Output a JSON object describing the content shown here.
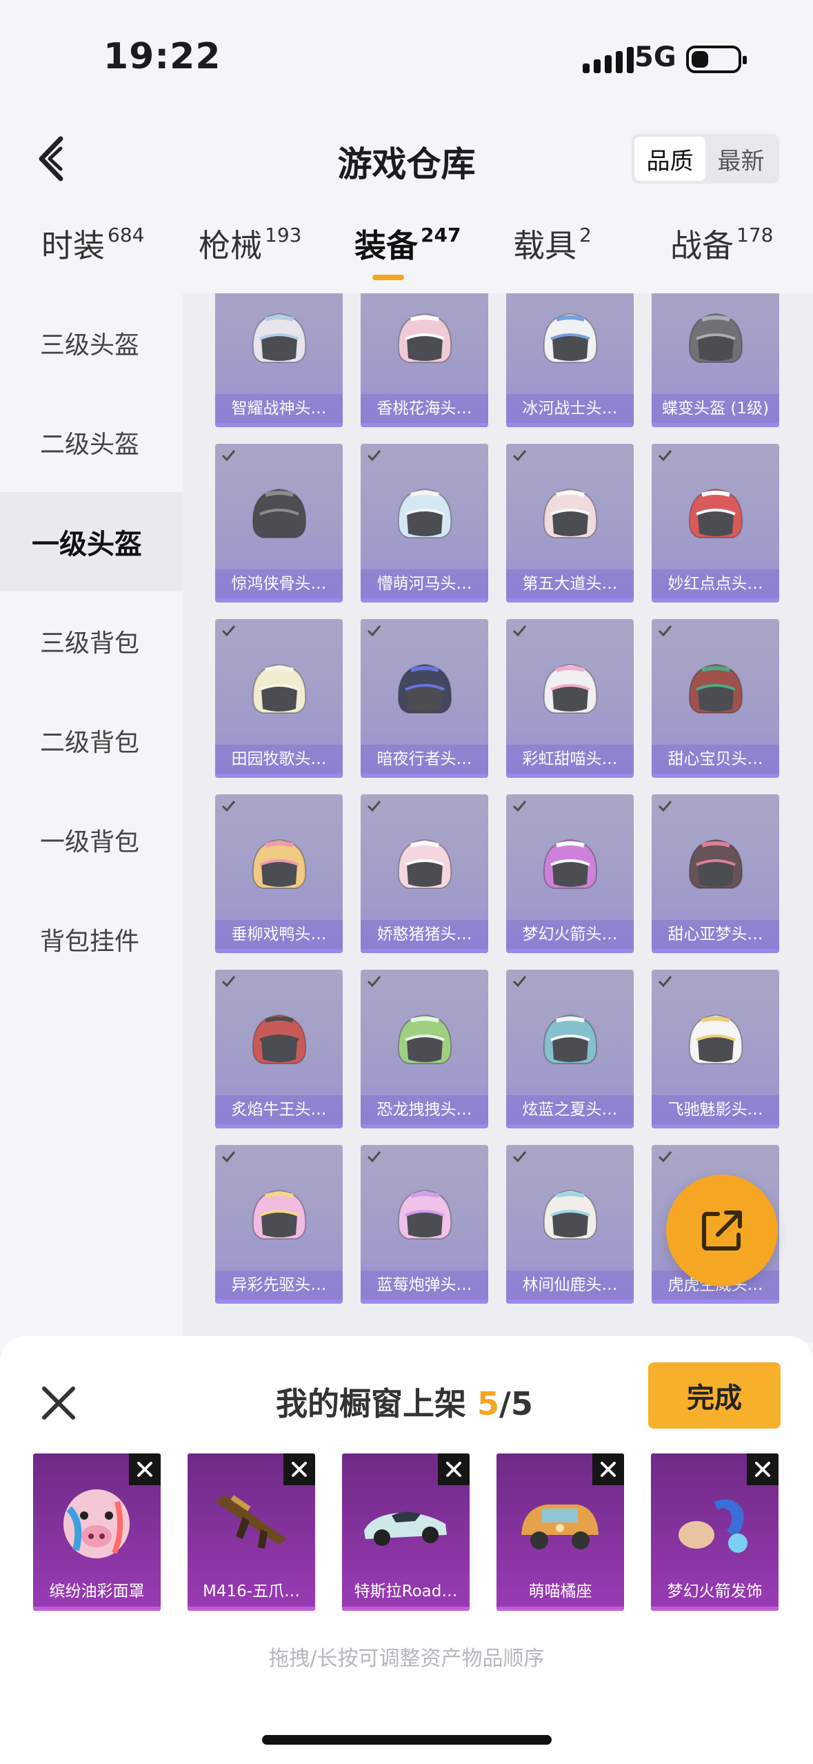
{
  "status_bar": {
    "time": "19:22",
    "network": "5G"
  },
  "nav": {
    "title": "游戏仓库",
    "sort_options": [
      "品质",
      "最新"
    ],
    "active_sort": "品质"
  },
  "categories": [
    {
      "label": "时装",
      "count": "684"
    },
    {
      "label": "枪械",
      "count": "193"
    },
    {
      "label": "装备",
      "count": "247"
    },
    {
      "label": "载具",
      "count": "2"
    },
    {
      "label": "战备",
      "count": "178"
    }
  ],
  "sidebar": {
    "items": [
      "三级头盔",
      "二级头盔",
      "一级头盔",
      "三级背包",
      "二级背包",
      "一级背包",
      "背包挂件"
    ],
    "active": "一级头盔"
  },
  "grid": {
    "items": [
      {
        "name": "智耀战神头…",
        "color": "#e6e4ea",
        "accent": "#a9c6e8"
      },
      {
        "name": "香桃花海头…",
        "color": "#f1c4cf",
        "accent": "#ffffff"
      },
      {
        "name": "冰河战士头…",
        "color": "#f2f2f4",
        "accent": "#5b8fd6"
      },
      {
        "name": "蝶变头盔 (1级)",
        "color": "#55565c",
        "accent": "#9aa0a8"
      },
      {
        "name": "惊鸿侠骨头…",
        "color": "#2b2b2e",
        "accent": "#777"
      },
      {
        "name": "懵萌河马头…",
        "color": "#cfe6f4",
        "accent": "#f7f7f7"
      },
      {
        "name": "第五大道头…",
        "color": "#f3d9d9",
        "accent": "#ffffff"
      },
      {
        "name": "妙红点点头…",
        "color": "#d73a3a",
        "accent": "#ffffff"
      },
      {
        "name": "田园牧歌头…",
        "color": "#f3ecc8",
        "accent": "#f9f5e0"
      },
      {
        "name": "暗夜行者头…",
        "color": "#1f2340",
        "accent": "#4b5bd8"
      },
      {
        "name": "彩虹甜喵头…",
        "color": "#f3f0f3",
        "accent": "#f0a3c6"
      },
      {
        "name": "甜心宝贝头…",
        "color": "#8e2f2a",
        "accent": "#2e9b6a"
      },
      {
        "name": "垂柳戏鸭头…",
        "color": "#f3c36b",
        "accent": "#f08aa0"
      },
      {
        "name": "娇憨猪猪头…",
        "color": "#f6d3dc",
        "accent": "#ffffff"
      },
      {
        "name": "梦幻火箭头…",
        "color": "#c86ad6",
        "accent": "#ffffff"
      },
      {
        "name": "甜心亚梦头…",
        "color": "#4a3036",
        "accent": "#d46a85"
      },
      {
        "name": "炙焰牛王头…",
        "color": "#c23a36",
        "accent": "#2a2a2a"
      },
      {
        "name": "恐龙拽拽头…",
        "color": "#8fca6a",
        "accent": "#e8f5dd"
      },
      {
        "name": "炫蓝之夏头…",
        "color": "#6fb7c6",
        "accent": "#f4f4f4"
      },
      {
        "name": "飞驰魅影头…",
        "color": "#f7f7f7",
        "accent": "#f0c95b"
      },
      {
        "name": "异彩先驱头…",
        "color": "#f3b1df",
        "accent": "#f7d56a"
      },
      {
        "name": "蓝莓炮弹头…",
        "color": "#f1b8e8",
        "accent": "#c98ee8"
      },
      {
        "name": "林间仙鹿头…",
        "color": "#f1eee6",
        "accent": "#8fd3e6"
      },
      {
        "name": "虎虎生威头…",
        "color": "#f2a43b",
        "accent": "#ffffff"
      }
    ]
  },
  "shelf": {
    "title_prefix": "我的橱窗上架",
    "count_current": "5",
    "count_sep_total": "/5",
    "done_label": "完成",
    "items": [
      {
        "name": "缤纷油彩面罩",
        "icon": "pig-mask-icon"
      },
      {
        "name": "M416-五爪…",
        "icon": "rifle-icon"
      },
      {
        "name": "特斯拉Road…",
        "icon": "sports-car-icon"
      },
      {
        "name": "萌喵橘座",
        "icon": "cat-car-icon"
      },
      {
        "name": "梦幻火箭发饰",
        "icon": "hair-accessory-icon"
      }
    ],
    "hint": "拖拽/长按可调整资产物品顺序"
  },
  "colors": {
    "accent": "#f5a623",
    "done_button": "#f7b02b"
  }
}
